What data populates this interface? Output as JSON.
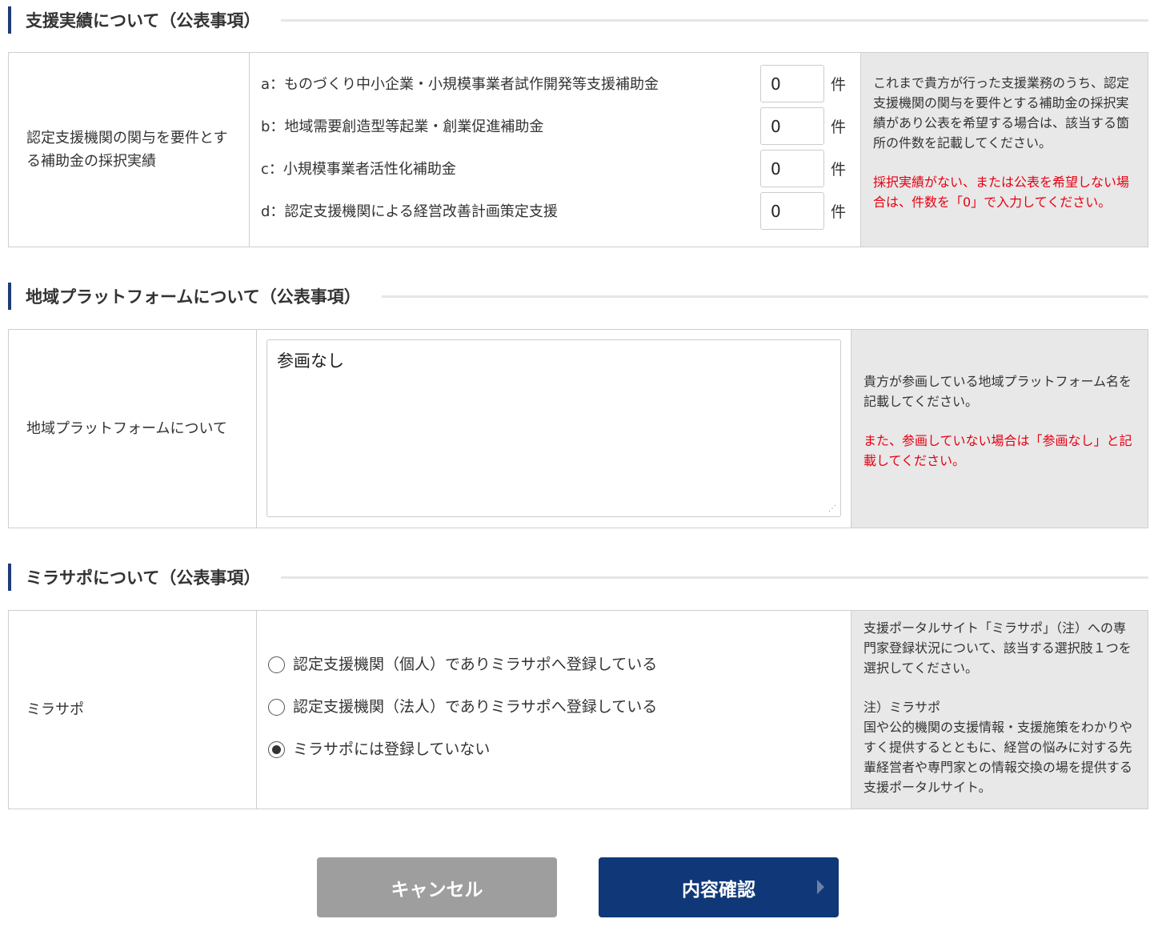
{
  "section1": {
    "title": "支援実績について（公表事項）",
    "label": "認定支援機関の関与を要件とする補助金の採択実績",
    "rows": [
      {
        "label": "a：ものづくり中小企業・小規模事業者試作開発等支援補助金",
        "value": "0",
        "unit": "件"
      },
      {
        "label": "b：地域需要創造型等起業・創業促進補助金",
        "value": "0",
        "unit": "件"
      },
      {
        "label": "c：小規模事業者活性化補助金",
        "value": "0",
        "unit": "件"
      },
      {
        "label": "d：認定支援機関による経営改善計画策定支援",
        "value": "0",
        "unit": "件"
      }
    ],
    "note": "これまで貴方が行った支援業務のうち、認定支援機関の関与を要件とする補助金の採択実績があり公表を希望する場合は、該当する箇所の件数を記載してください。",
    "note_red": "採択実績がない、または公表を希望しない場合は、件数を「0」で入力してください。"
  },
  "section2": {
    "title": "地域プラットフォームについて（公表事項）",
    "label": "地域プラットフォームについて",
    "value": "参画なし",
    "note": "貴方が参画している地域プラットフォーム名を記載してください。",
    "note_red": "また、参画していない場合は「参画なし」と記載してください。"
  },
  "section3": {
    "title": "ミラサポについて（公表事項）",
    "label": "ミラサポ",
    "options": [
      {
        "label": "認定支援機関（個人）でありミラサポへ登録している",
        "selected": false
      },
      {
        "label": "認定支援機関（法人）でありミラサポへ登録している",
        "selected": false
      },
      {
        "label": "ミラサポには登録していない",
        "selected": true
      }
    ],
    "note": "支援ポータルサイト「ミラサポ」（注）への専門家登録状況について、該当する選択肢１つを選択してください。",
    "note2_title": "注）ミラサポ",
    "note2": "国や公的機関の支援情報・支援施策をわかりやすく提供するとともに、経営の悩みに対する先輩経営者や専門家との情報交換の場を提供する支援ポータルサイト。"
  },
  "buttons": {
    "cancel": "キャンセル",
    "confirm": "内容確認"
  },
  "colors": {
    "accent": "#103878",
    "heading_bar": "#1f3c78",
    "note_bg": "#e8e8e8",
    "warning": "#e60012",
    "cancel_bg": "#9e9e9e"
  }
}
